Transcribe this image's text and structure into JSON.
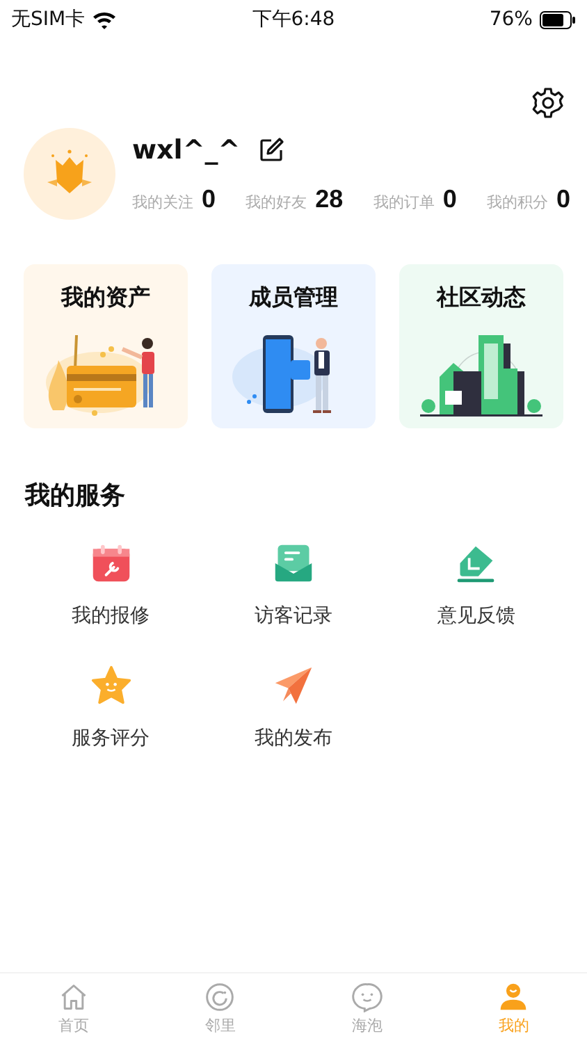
{
  "status_bar": {
    "carrier": "无SIM卡",
    "time": "下午6:48",
    "battery": "76%"
  },
  "profile": {
    "name": "wxl^_^",
    "stats": [
      {
        "label": "我的关注",
        "value": "0"
      },
      {
        "label": "我的好友",
        "value": "28"
      },
      {
        "label": "我的订单",
        "value": "0"
      },
      {
        "label": "我的积分",
        "value": "0"
      }
    ]
  },
  "cards": [
    {
      "kind": "assets",
      "title": "我的资产"
    },
    {
      "kind": "members",
      "title": "成员管理"
    },
    {
      "kind": "community",
      "title": "社区动态"
    }
  ],
  "services": {
    "title": "我的服务",
    "items": [
      {
        "kind": "repair",
        "label": "我的报修"
      },
      {
        "kind": "visitor",
        "label": "访客记录"
      },
      {
        "kind": "feedback",
        "label": "意见反馈"
      },
      {
        "kind": "rating",
        "label": "服务评分"
      },
      {
        "kind": "publish",
        "label": "我的发布"
      }
    ]
  },
  "tab_bar": [
    {
      "kind": "home",
      "label": "首页",
      "selected": false
    },
    {
      "kind": "neighbor",
      "label": "邻里",
      "selected": false
    },
    {
      "kind": "bubble",
      "label": "海泡",
      "selected": false
    },
    {
      "kind": "me",
      "label": "我的",
      "selected": true
    }
  ]
}
